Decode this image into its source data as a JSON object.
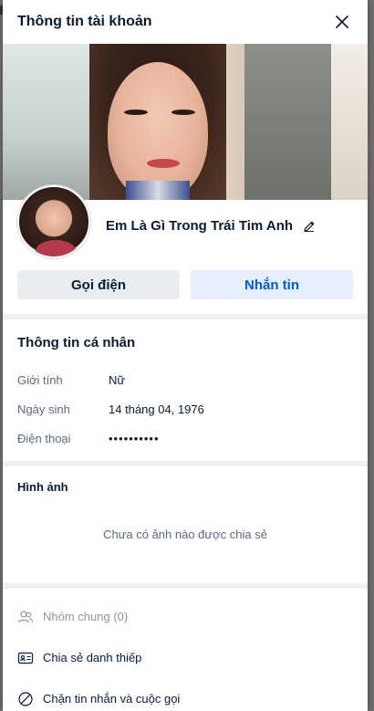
{
  "header": {
    "title": "Thông tin tài khoản"
  },
  "profile": {
    "display_name": "Em Là Gì Trong Trái Tim Anh"
  },
  "actions": {
    "call_label": "Gọi điện",
    "message_label": "Nhắn tin"
  },
  "personal_info": {
    "title": "Thông tin cá nhân",
    "rows": [
      {
        "label": "Giới tính",
        "value": "Nữ"
      },
      {
        "label": "Ngày sinh",
        "value": "14 tháng 04, 1976"
      },
      {
        "label": "Điện thoại",
        "value": "••••••••••"
      }
    ]
  },
  "photos": {
    "title": "Hình ảnh",
    "empty_text": "Chưa có ảnh nào được chia sẻ"
  },
  "menu": {
    "common_groups": "Nhóm chung (0)",
    "share_card": "Chia sẻ danh thiếp",
    "block": "Chặn tin nhắn và cuộc gọi"
  },
  "icons": [
    "close-icon",
    "edit-icon",
    "users-icon",
    "contact-card-icon",
    "block-icon"
  ],
  "colors": {
    "primary": "#005ae0",
    "message_bg": "#e5efff",
    "call_bg": "#eaedf0",
    "text": "#081c36",
    "muted": "#5a6981"
  }
}
